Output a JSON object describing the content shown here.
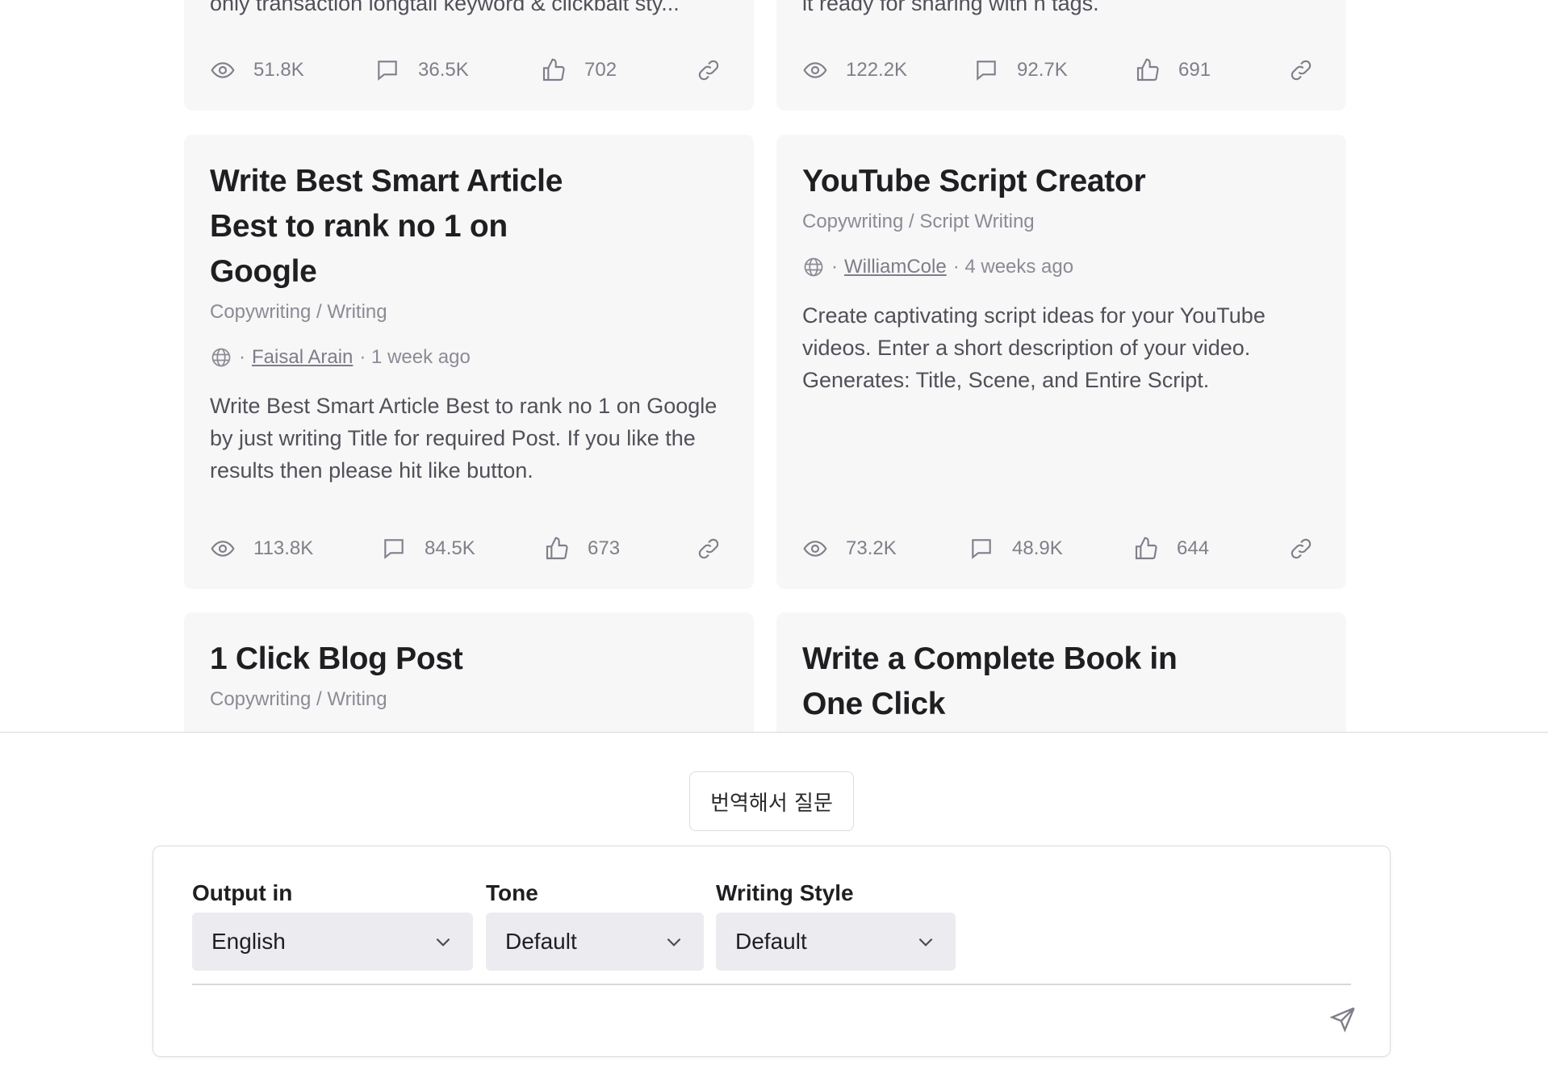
{
  "cards": {
    "top_left": {
      "desc_fragment": "only transaction longtail keyword & clickbait sty...",
      "views": "51.8K",
      "comments": "36.5K",
      "likes": "702"
    },
    "top_right": {
      "desc_fragment": "it ready for sharing with h tags.",
      "views": "122.2K",
      "comments": "92.7K",
      "likes": "691"
    },
    "mid_left": {
      "title": "Write Best Smart Article Best to rank no 1 on Google",
      "title_lines": [
        "Write Best Smart Article",
        "Best to rank no 1 on",
        "Google"
      ],
      "category": "Copywriting / Writing",
      "author": "Faisal Arain",
      "time": "· 1 week ago",
      "description": "Write Best Smart Article Best to rank no 1 on Google by just writing Title for required Post. If you like the results then please hit like button.",
      "views": "113.8K",
      "comments": "84.5K",
      "likes": "673"
    },
    "mid_right": {
      "title": "YouTube Script Creator",
      "category": "Copywriting / Script Writing",
      "author": "WilliamCole",
      "time": "· 4 weeks ago",
      "description": "Create captivating script ideas for your YouTube videos. Enter a short description of your video. Generates: Title, Scene, and Entire Script.",
      "views": "73.2K",
      "comments": "48.9K",
      "likes": "644"
    },
    "bottom_left": {
      "title": "1 Click Blog Post",
      "category": "Copywriting / Writing"
    },
    "bottom_right": {
      "title_lines": [
        "Write a Complete Book in",
        "One Click"
      ]
    }
  },
  "translate_button": "번역해서 질문",
  "composer": {
    "output_label": "Output in",
    "output_value": "English",
    "tone_label": "Tone",
    "tone_value": "Default",
    "style_label": "Writing Style",
    "style_value": "Default"
  },
  "icons": {
    "views": "eye-icon",
    "comments": "comment-icon",
    "likes": "thumbs-up-icon",
    "link": "link-icon",
    "author": "globe-icon",
    "dropdown": "chevron-down-icon",
    "send": "send-icon"
  }
}
